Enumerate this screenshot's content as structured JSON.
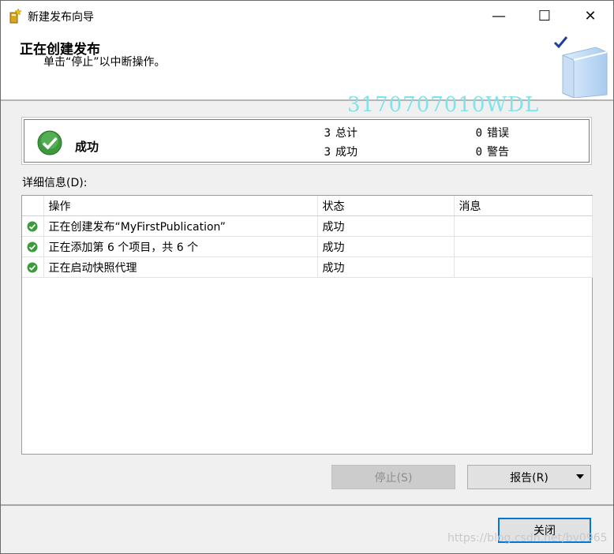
{
  "window": {
    "title": "新建发布向导"
  },
  "title_buttons": {
    "minimize": "—",
    "maximize": "☐",
    "close": "✕"
  },
  "header": {
    "title": "正在创建发布",
    "subtitle": "单击“停止”以中断操作。"
  },
  "watermark": "3170707010WDL",
  "summary": {
    "status": "成功",
    "total_count": "3",
    "total_label": "总计",
    "success_count": "3",
    "success_label": "成功",
    "error_count": "0",
    "error_label": "错误",
    "warning_count": "0",
    "warning_label": "警告"
  },
  "details": {
    "label": "详细信息(D):",
    "columns": [
      "操作",
      "状态",
      "消息"
    ],
    "rows": [
      {
        "action": "正在创建发布“MyFirstPublication”",
        "status": "成功",
        "message": ""
      },
      {
        "action": "正在添加第 6 个项目，共 6 个",
        "status": "成功",
        "message": ""
      },
      {
        "action": "正在启动快照代理",
        "status": "成功",
        "message": ""
      }
    ]
  },
  "buttons": {
    "stop": "停止(S)",
    "report": "报告(R)",
    "close": "关闭"
  },
  "footer_watermark": "https://blog.csdn.net/bv0965",
  "colors": {
    "success_green": "#3c9a3c",
    "accent_blue": "#0078d7",
    "watermark_cyan": "#7fe3ea"
  }
}
